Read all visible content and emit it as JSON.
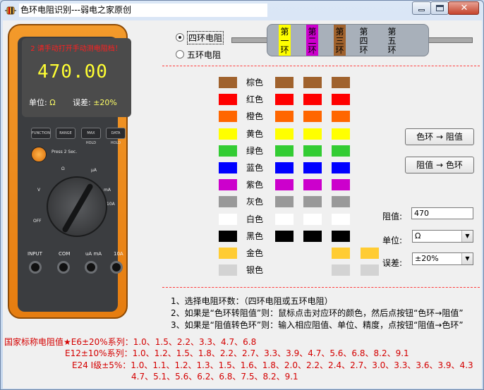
{
  "window": {
    "title": "色环电阻识别---弱电之家原创"
  },
  "meter": {
    "warning": "2 请手动打开手动测电阻档！",
    "display_value": "470.00",
    "unit_label": "单位:",
    "unit_value": "Ω",
    "tolerance_label": "误差:",
    "tolerance_value": "±20%",
    "keys": [
      "FUNCTION",
      "RANGE",
      "MAX HOLD",
      "DATA HOLD"
    ],
    "press_text": "Press 2 Sec.",
    "range_marks": [
      "V",
      "Ω",
      "µA",
      "mA",
      "10A",
      "OFF"
    ],
    "jacks": [
      "INPUT",
      "COM",
      "uA mA",
      "10A"
    ]
  },
  "ring_mode": {
    "options": [
      "四环电阻",
      "五环电阻"
    ],
    "selected": 0
  },
  "resistor": {
    "bands": [
      {
        "label": "第\n一\n环",
        "color": "#ffff00"
      },
      {
        "label": "第\n二\n环",
        "color": "#cc00cc"
      },
      {
        "label": "第\n三\n环",
        "color": "#a0622d"
      },
      {
        "label": "第\n四\n环",
        "color": "#a8b0ba"
      },
      {
        "label": "第\n五\n环",
        "color": "#a8b0ba"
      }
    ]
  },
  "color_table": {
    "names": [
      "棕色",
      "红色",
      "橙色",
      "黄色",
      "绿色",
      "蓝色",
      "紫色",
      "灰色",
      "白色",
      "黑色",
      "金色",
      "银色"
    ],
    "colors": [
      "#a0622d",
      "#ff0000",
      "#ff6600",
      "#ffff00",
      "#33cc33",
      "#0000ff",
      "#cc00cc",
      "#999999",
      "#ffffff",
      "#000000",
      "#ffcc33",
      "#d3d3d3"
    ]
  },
  "buttons": {
    "to_value": "色环 → 阻值",
    "to_color": "阻值 → 色环"
  },
  "fields": {
    "resistance_label": "阻值:",
    "resistance_value": "470",
    "unit_label": "单位:",
    "unit_value": "Ω",
    "tolerance_label": "误差:",
    "tolerance_value": "±20%"
  },
  "instructions": [
    "1、选择电阻环数：（四环电阻或五环电阻）",
    "2、如果是“色环转阻值”则：鼠标点击对应环的颜色，然后点按钮“色环→阻值”",
    "3、如果是“阻值转色环”则：输入相应阻值、单位、精度，点按钮“阻值→色环”"
  ],
  "series": {
    "e6": "国家标称电阻值★E6±20%系列：1.0、1.5、2.2、3.3、4.7、6.8",
    "e12": "E12±10%系列：1.0、1.2、1.5、1.8、2.2、2.7、3.3、3.9、4.7、5.6、6.8、8.2、9.1",
    "e24_a": "E24 I级±5%：1.0、1.1、1.2、1.3、1.5、1.6、1.8、2.0、2.2、2.4、2.7、3.0、3.3、3.6、3.9、4.3",
    "e24_b": "4.7、5.1、5.6、6.2、6.8、7.5、8.2、9.1"
  }
}
